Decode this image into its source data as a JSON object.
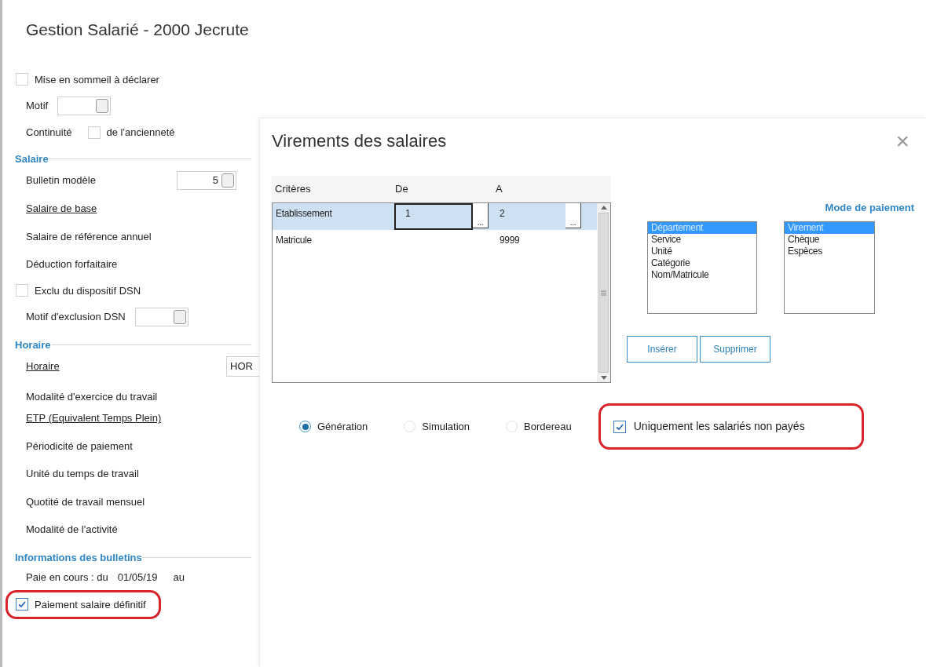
{
  "employee_form": {
    "title": "Gestion Salarié - 2000 Jecrute",
    "items": [
      {
        "kind": "checkbox",
        "label": "Mise en sommeil à déclarer",
        "checked": false,
        "highlighted": false
      },
      {
        "kind": "lookup",
        "label": "Motif"
      },
      {
        "kind": "inline_checkbox",
        "label": "Continuité",
        "suffix": "de l'ancienneté",
        "checked": false
      },
      {
        "kind": "section",
        "label": "Salaire"
      },
      {
        "kind": "lookup",
        "label": "Bulletin modèle",
        "value": "5"
      },
      {
        "kind": "link",
        "label": "Salaire de base"
      },
      {
        "kind": "text",
        "label": "Salaire de référence annuel"
      },
      {
        "kind": "text",
        "label": "Déduction forfaitaire"
      },
      {
        "kind": "checkbox",
        "label": "Exclu du dispositif DSN",
        "checked": false,
        "highlighted": false
      },
      {
        "kind": "lookup",
        "label": "Motif d'exclusion DSN"
      },
      {
        "kind": "section",
        "label": "Horaire"
      },
      {
        "kind": "link_field",
        "label": "Horaire",
        "value": "HOR"
      },
      {
        "kind": "text_tight",
        "label": "Modalité d'exercice du travail"
      },
      {
        "kind": "link",
        "label": "ETP (Equivalent Temps Plein)"
      },
      {
        "kind": "text",
        "label": "Périodicité de paiement"
      },
      {
        "kind": "text",
        "label": "Unité du temps de travail"
      },
      {
        "kind": "text",
        "label": "Quotité de travail mensuel"
      },
      {
        "kind": "text",
        "label": "Modalité de l'activité"
      },
      {
        "kind": "section",
        "label": "Informations des bulletins"
      },
      {
        "kind": "period",
        "label": "Paie en cours : du",
        "value": "01/05/19",
        "suffix": "au"
      },
      {
        "kind": "checkbox",
        "label": "Paiement salaire définitif",
        "checked": true,
        "highlighted": true
      }
    ]
  },
  "dialog": {
    "title": "Virements des salaires",
    "close": "×",
    "table": {
      "columns": [
        "Critères",
        "De",
        "A"
      ],
      "rows": [
        {
          "criteria": "Etablissement",
          "from": "1",
          "from_button": "...",
          "to": "2",
          "to_button": "...",
          "selected": true
        },
        {
          "criteria": "Matricule",
          "to": "9999",
          "selected": false
        }
      ]
    },
    "sort_list": [
      {
        "label": "Département",
        "selected": true
      },
      {
        "label": "Service",
        "selected": false
      },
      {
        "label": "Unité",
        "selected": false
      },
      {
        "label": "Catégorie",
        "selected": false
      },
      {
        "label": "Nom/Matricule",
        "selected": false
      }
    ],
    "payment_mode": {
      "title": "Mode de paiement",
      "items": [
        {
          "label": "Virement",
          "selected": true
        },
        {
          "label": "Chèque",
          "selected": false
        },
        {
          "label": "Espèces",
          "selected": false
        }
      ]
    },
    "buttons": [
      "Insérer",
      "Supprimer"
    ],
    "modes": [
      {
        "label": "Génération",
        "selected": true
      },
      {
        "label": "Simulation",
        "selected": false
      },
      {
        "label": "Bordereau",
        "selected": false
      }
    ],
    "unpaid_only": {
      "label": "Uniquement les salariés non payés",
      "checked": true,
      "highlighted": true
    }
  }
}
